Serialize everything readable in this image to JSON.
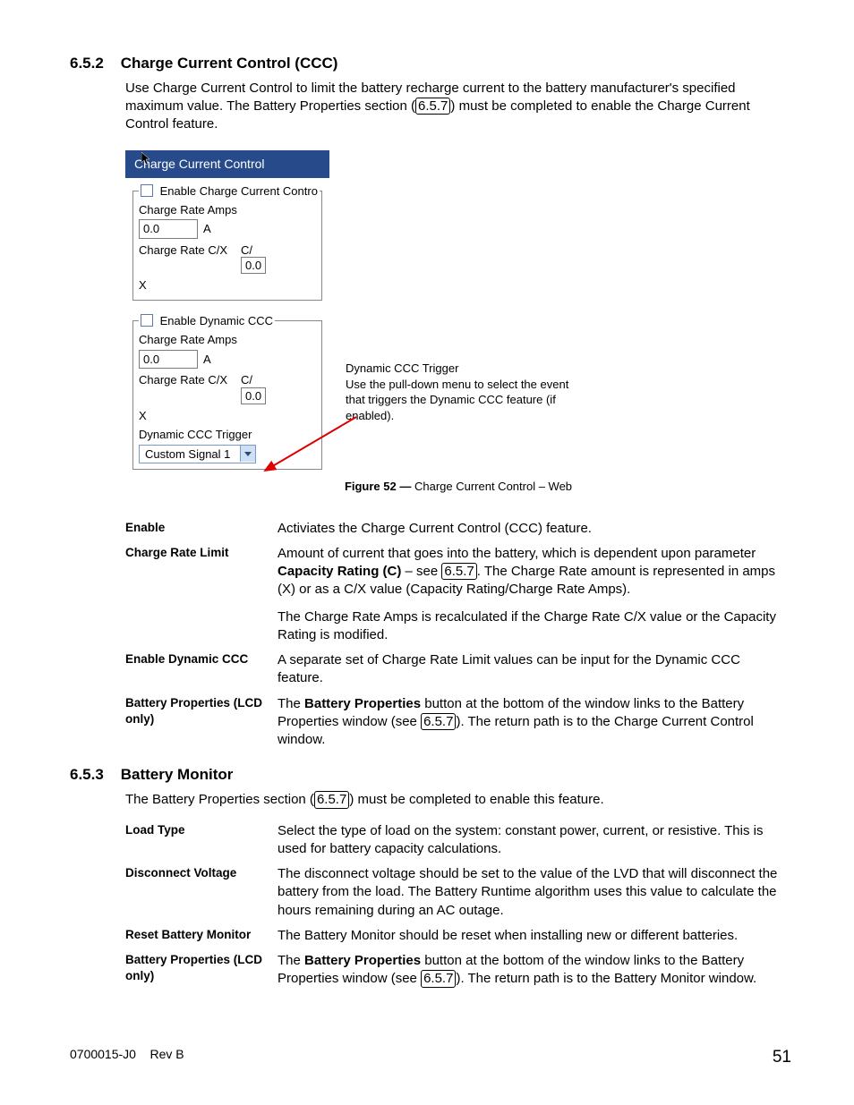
{
  "sections": {
    "s652": {
      "num": "6.5.2",
      "title": "Charge Current Control (CCC)"
    },
    "s653": {
      "num": "6.5.3",
      "title": "Battery Monitor"
    }
  },
  "paragraphs": {
    "p652": {
      "a": "Use Charge Current Control to limit the battery recharge current to the battery manufacturer's specified maximum value. The Battery Properties section (",
      "xref": "6.5.7",
      "b": ") must be completed to enable the Charge Current Control feature."
    },
    "p653": {
      "a": "The Battery Properties section (",
      "xref": "6.5.7",
      "b": ") must be completed to enable this feature."
    }
  },
  "panel": {
    "title": "Charge Current Control",
    "group1": {
      "legend": " Enable Charge Current Contro",
      "rate_amps_lbl": "Charge Rate Amps",
      "rate_amps_val": "0.0",
      "unit_a": "A",
      "rate_cx_lbl": "Charge Rate C/X",
      "c_over": "C/",
      "cx_val": "0.0",
      "x": "X"
    },
    "group2": {
      "legend": " Enable Dynamic CCC",
      "rate_amps_lbl": "Charge Rate Amps",
      "rate_amps_val": "0.0",
      "unit_a": "A",
      "rate_cx_lbl": "Charge Rate C/X",
      "c_over": "C/",
      "cx_val": "0.0",
      "x": "X",
      "trigger_lbl": "Dynamic CCC Trigger",
      "trigger_val": "Custom Signal 1"
    }
  },
  "callout": {
    "title": "Dynamic CCC Trigger",
    "text": "Use the pull-down menu to select the event that triggers the Dynamic CCC feature (if enabled)."
  },
  "figure": {
    "label": "Figure 52  —",
    "caption": "  Charge Current Control – Web"
  },
  "defs652": {
    "r1": {
      "term": "Enable",
      "desc": "Activiates the Charge Current Control (CCC) feature."
    },
    "r2": {
      "term": "Charge Rate Limit",
      "a": "Amount of current that goes into the battery, which is dependent upon parameter ",
      "bold": "Capacity Rating (C)",
      "mid": " – see ",
      "xref": "6.5.7",
      "b": ". The Charge Rate amount is represented in amps (X) or as a C/X value (Capacity Rating/Charge Rate Amps).",
      "p2": "The Charge Rate Amps is recalculated if the Charge Rate C/X value or the Capacity Rating is modified."
    },
    "r3": {
      "term": "Enable Dynamic CCC",
      "desc": "A separate set of Charge Rate Limit values can be input for the Dynamic CCC feature."
    },
    "r4": {
      "term": "Battery Properties (LCD only)",
      "a": "The ",
      "bold": "Battery Properties",
      "mid": " button at the bottom of the window links to the Battery Properties window (see ",
      "xref": "6.5.7",
      "b": "). The return path is to the Charge Current Control window."
    }
  },
  "defs653": {
    "r1": {
      "term": "Load Type",
      "desc": "Select the type of load on the system: constant power, current, or resistive. This is used for battery capacity calculations."
    },
    "r2": {
      "term": "Disconnect Voltage",
      "desc": "The disconnect voltage should be set to the value of the LVD that will disconnect the battery from the load. The Battery Runtime algorithm uses this value to calculate the hours remaining during an AC outage."
    },
    "r3": {
      "term": "Reset Battery Monitor",
      "desc": "The Battery Monitor should be reset when installing new or different batteries."
    },
    "r4": {
      "term": "Battery Properties (LCD only)",
      "a": "The ",
      "bold": "Battery Properties",
      "mid": " button at the bottom of the window links to the Battery Properties window (see ",
      "xref": "6.5.7",
      "b": "). The return path is to the Battery Monitor window."
    }
  },
  "footer": {
    "doc": "0700015-J0",
    "rev": "Rev B",
    "page": "51"
  }
}
